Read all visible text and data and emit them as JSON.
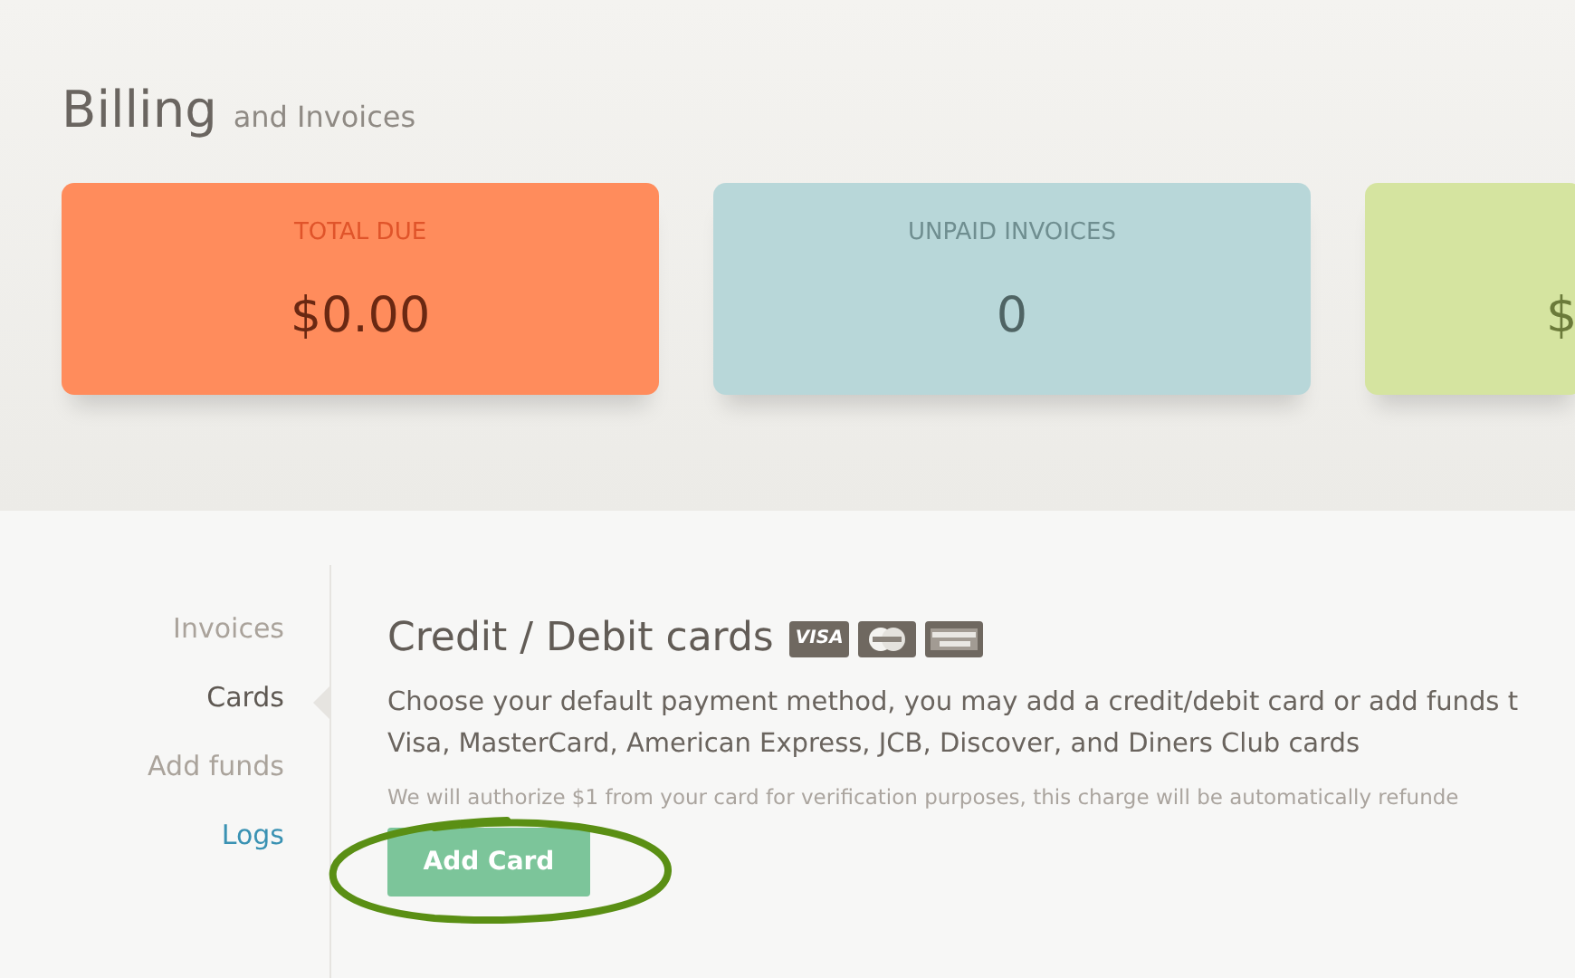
{
  "page_title": {
    "main": "Billing",
    "sub": "and Invoices"
  },
  "summary_cards": [
    {
      "kind": "total",
      "label": "TOTAL DUE",
      "value": "$0.00"
    },
    {
      "kind": "unpaid",
      "label": "UNPAID INVOICES",
      "value": "0"
    },
    {
      "kind": "credit",
      "value": "$"
    }
  ],
  "sidebar": {
    "items": [
      {
        "label": "Invoices",
        "kind": "nav",
        "selected": false
      },
      {
        "label": "Cards",
        "kind": "nav",
        "selected": true
      },
      {
        "label": "Add funds",
        "kind": "nav",
        "selected": false
      },
      {
        "label": "Logs",
        "kind": "link",
        "selected": false
      }
    ]
  },
  "section": {
    "heading": "Credit / Debit cards",
    "card_logos": [
      {
        "kind": "visa",
        "label": "VISA"
      },
      {
        "kind": "mastercard"
      },
      {
        "kind": "amex"
      }
    ],
    "description_lines": [
      "Choose your default payment method, you may add a credit/debit card or add funds t",
      "Visa, MasterCard, American Express, JCB, Discover, and Diners Club cards"
    ],
    "note": "We will authorize $1 from your card for verification purposes, this charge will be automatically refunde",
    "button": "Add Card"
  }
}
